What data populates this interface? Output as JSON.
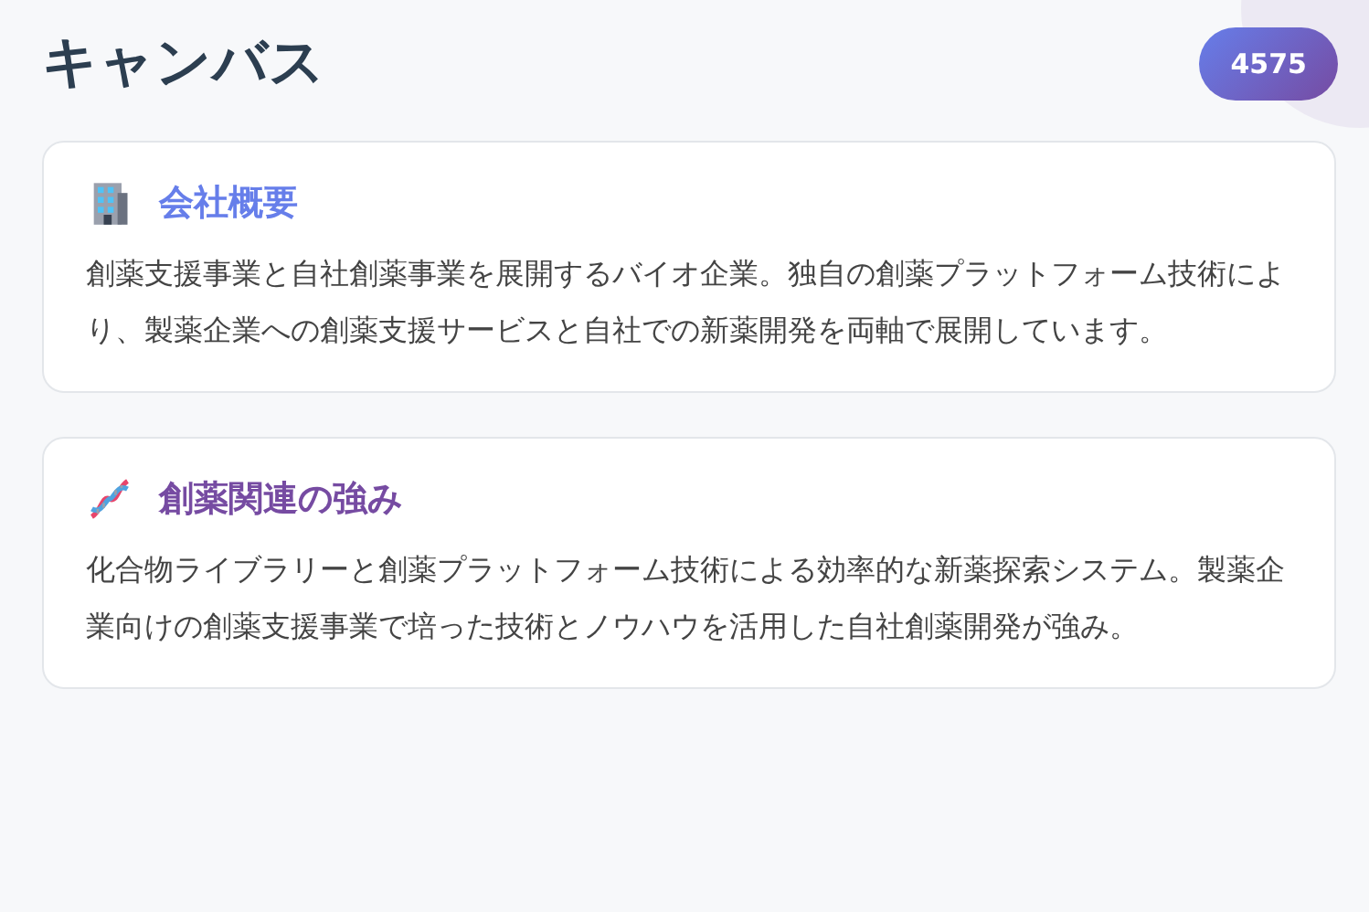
{
  "header": {
    "title": "キャンバス",
    "badge": "4575"
  },
  "cards": [
    {
      "kind": "building",
      "title": "会社概要",
      "color": "#667eea",
      "body": "創薬支援事業と自社創薬事業を展開するバイオ企業。独自の創薬プラットフォーム技術により、製薬企業への創薬支援サービスと自社での新薬開発を両軸で展開しています。"
    },
    {
      "kind": "dna",
      "title": "創薬関連の強み",
      "color": "#764ba2",
      "body": "化合物ライブラリーと創薬プラットフォーム技術による効率的な新薬探索システム。製薬企業向けの創薬支援事業で培った技術とノウハウを活用した自社創薬開発が強み。"
    }
  ]
}
